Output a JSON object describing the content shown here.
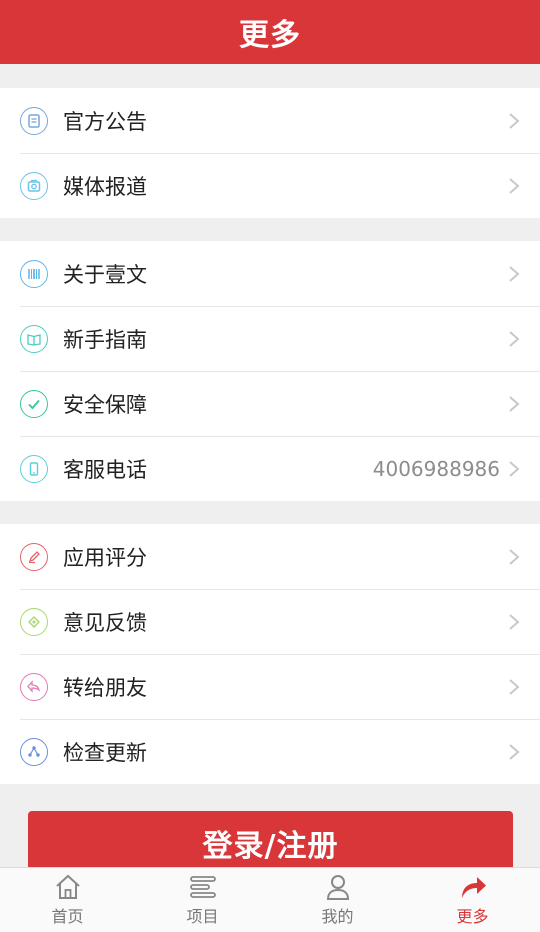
{
  "header": {
    "title": "更多"
  },
  "groups": [
    {
      "items": [
        {
          "label": "官方公告",
          "icon": "announcement-icon",
          "color": "#7aa6d8"
        },
        {
          "label": "媒体报道",
          "icon": "media-report-icon",
          "color": "#6cc3e6"
        }
      ]
    },
    {
      "items": [
        {
          "label": "关于壹文",
          "icon": "about-icon",
          "color": "#5cb8e8"
        },
        {
          "label": "新手指南",
          "icon": "guide-icon",
          "color": "#4ccdc0"
        },
        {
          "label": "安全保障",
          "icon": "security-icon",
          "color": "#38c79b"
        },
        {
          "label": "客服电话",
          "icon": "phone-icon",
          "color": "#56d3d7",
          "value": "4006988986"
        }
      ]
    },
    {
      "items": [
        {
          "label": "应用评分",
          "icon": "rating-icon",
          "color": "#e4646a"
        },
        {
          "label": "意见反馈",
          "icon": "feedback-icon",
          "color": "#a7d96e"
        },
        {
          "label": "转给朋友",
          "icon": "share-friend-icon",
          "color": "#e27ab7"
        },
        {
          "label": "检查更新",
          "icon": "update-icon",
          "color": "#6c8fd8"
        }
      ]
    }
  ],
  "login_button": "登录/注册",
  "tabs": [
    {
      "label": "首页",
      "icon": "home-icon"
    },
    {
      "label": "项目",
      "icon": "project-icon"
    },
    {
      "label": "我的",
      "icon": "profile-icon"
    },
    {
      "label": "更多",
      "icon": "more-icon",
      "active": true
    }
  ],
  "colors": {
    "brand": "#d9363a",
    "background": "#efefef"
  }
}
